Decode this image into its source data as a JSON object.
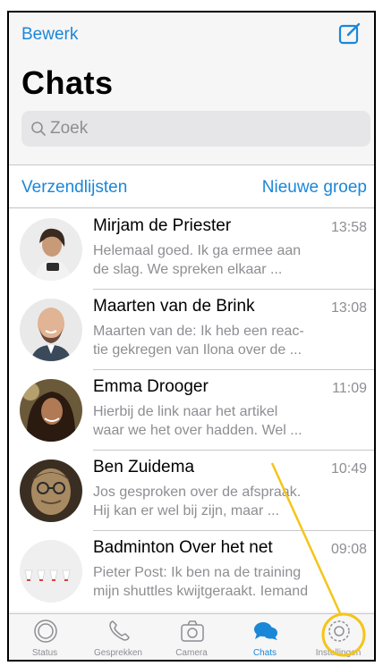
{
  "header": {
    "edit_label": "Bewerk",
    "title": "Chats",
    "search_placeholder": "Zoek"
  },
  "lists": {
    "broadcast_label": "Verzendlijsten",
    "new_group_label": "Nieuwe groep"
  },
  "chats": [
    {
      "name": "Mirjam de Priester",
      "time": "13:58",
      "preview_line1": "Helemaal goed. Ik ga ermee aan",
      "preview_line2": "de slag. We spreken elkaar ..."
    },
    {
      "name": "Maarten van de Brink",
      "time": "13:08",
      "preview_line1": "Maarten van de: Ik heb een reac-",
      "preview_line2": "tie gekregen van Ilona over de ..."
    },
    {
      "name": "Emma Drooger",
      "time": "11:09",
      "preview_line1": "Hierbij de link naar het artikel",
      "preview_line2": "waar we het over hadden. Wel ..."
    },
    {
      "name": "Ben Zuidema",
      "time": "10:49",
      "preview_line1": "Jos gesproken over de afspraak.",
      "preview_line2": "Hij kan er wel bij zijn, maar ..."
    },
    {
      "name": "Badminton Over het net",
      "time": "09:08",
      "preview_line1": "Pieter Post: Ik ben na de training",
      "preview_line2": "mijn shuttles kwijtgeraakt. Iemand"
    }
  ],
  "tabs": [
    {
      "label": "Status",
      "icon": "status-icon"
    },
    {
      "label": "Gesprekken",
      "icon": "phone-icon"
    },
    {
      "label": "Camera",
      "icon": "camera-icon"
    },
    {
      "label": "Chats",
      "icon": "chats-icon",
      "active": true
    },
    {
      "label": "Instellingen",
      "icon": "settings-icon"
    }
  ],
  "colors": {
    "accent": "#1a87d8",
    "annotation": "#f5c518",
    "secondary_text": "#8e8e93"
  }
}
